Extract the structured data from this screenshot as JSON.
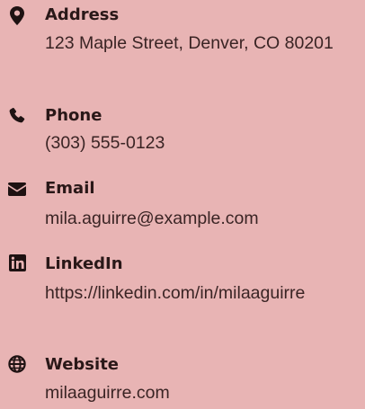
{
  "contacts": [
    {
      "icon": "map-pin-icon",
      "label": "Address",
      "value": "123 Maple Street, Denver, CO 80201"
    },
    {
      "icon": "phone-icon",
      "label": "Phone",
      "value": "(303) 555-0123"
    },
    {
      "icon": "envelope-icon",
      "label": "Email",
      "value": "mila.aguirre@example.com"
    },
    {
      "icon": "linkedin-icon",
      "label": "LinkedIn",
      "value": "https://linkedin.com/in/milaaguirre"
    },
    {
      "icon": "globe-icon",
      "label": "Website",
      "value": "milaaguirre.com"
    }
  ],
  "colors": {
    "background": "#e8b4b4",
    "text": "#2b1b1b"
  }
}
